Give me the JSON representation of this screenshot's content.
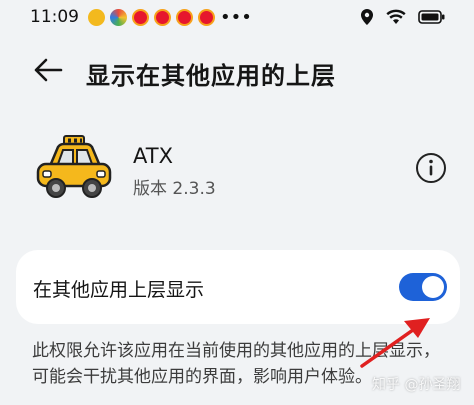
{
  "status_bar": {
    "time": "11:09",
    "notification_icons": [
      "taxi-icon",
      "app-icon",
      "weibo-icon",
      "weibo-icon",
      "weibo-icon",
      "weibo-icon",
      "dots-icon"
    ],
    "right_icons": [
      "location-icon",
      "wifi-icon",
      "battery-icon"
    ]
  },
  "header": {
    "back_icon": "back-arrow-icon",
    "title": "显示在其他应用的上层"
  },
  "app": {
    "name": "ATX",
    "version": "版本 2.3.3",
    "info_icon": "info-icon"
  },
  "setting": {
    "label": "在其他应用上层显示",
    "enabled": true,
    "toggle_color": "#1e62d8"
  },
  "description": "此权限允许该应用在当前使用的其他应用的上层显示，可能会干扰其他应用的界面，影响用户体验。",
  "watermark": "知乎 @孙圣翔",
  "annotation": {
    "arrow_color": "#e02020"
  }
}
